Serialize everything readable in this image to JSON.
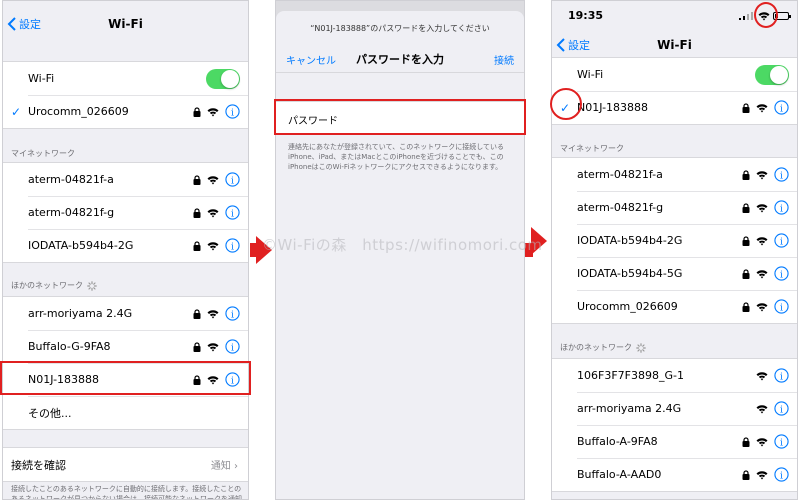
{
  "panel1": {
    "back_label": "設定",
    "title": "Wi-Fi",
    "wifi_label": "Wi-Fi",
    "connected": "Urocomm_026609",
    "my_networks_label": "マイネットワーク",
    "my_networks": [
      "aterm-04821f-a",
      "aterm-04821f-g",
      "IODATA-b594b4-2G"
    ],
    "other_networks_label": "ほかのネットワーク",
    "other_networks": [
      "arr-moriyama 2.4G",
      "Buffalo-G-9FA8",
      "N01J-183888"
    ],
    "other_item": "その他...",
    "ask_join_label": "接続を確認",
    "ask_join_value": "通知",
    "ask_join_desc": "接続したことのあるネットワークに自動的に接続します。接続したことのあるネットワークが見つからない場合は、接続可能なネットワークを通知します。"
  },
  "panel2": {
    "prompt": "“N01J-183888”のパスワードを入力してください",
    "cancel": "キャンセル",
    "title": "パスワードを入力",
    "join": "接続",
    "password_label": "パスワード",
    "desc": "連絡先にあなたが登録されていて、このネットワークに接続しているiPhone、iPad、またはMacとこのiPhoneを近づけることでも、このiPhoneはこのWi-Fiネットワークにアクセスできるようになります。"
  },
  "panel3": {
    "time": "19:35",
    "back_label": "設定",
    "title": "Wi-Fi",
    "wifi_label": "Wi-Fi",
    "connected": "N01J-183888",
    "my_networks_label": "マイネットワーク",
    "my_networks": [
      "aterm-04821f-a",
      "aterm-04821f-g",
      "IODATA-b594b4-2G",
      "IODATA-b594b4-5G",
      "Urocomm_026609"
    ],
    "other_networks_label": "ほかのネットワーク",
    "other_networks": [
      "106F3F7F3898_G-1",
      "arr-moriyama 2.4G",
      "Buffalo-A-9FA8",
      "Buffalo-A-AAD0"
    ]
  },
  "watermark": "©Wi-Fiの森　https://wifinomori.com",
  "colors": {
    "accent": "#007aff",
    "toggle_on": "#4cd964",
    "highlight": "#e02020"
  }
}
